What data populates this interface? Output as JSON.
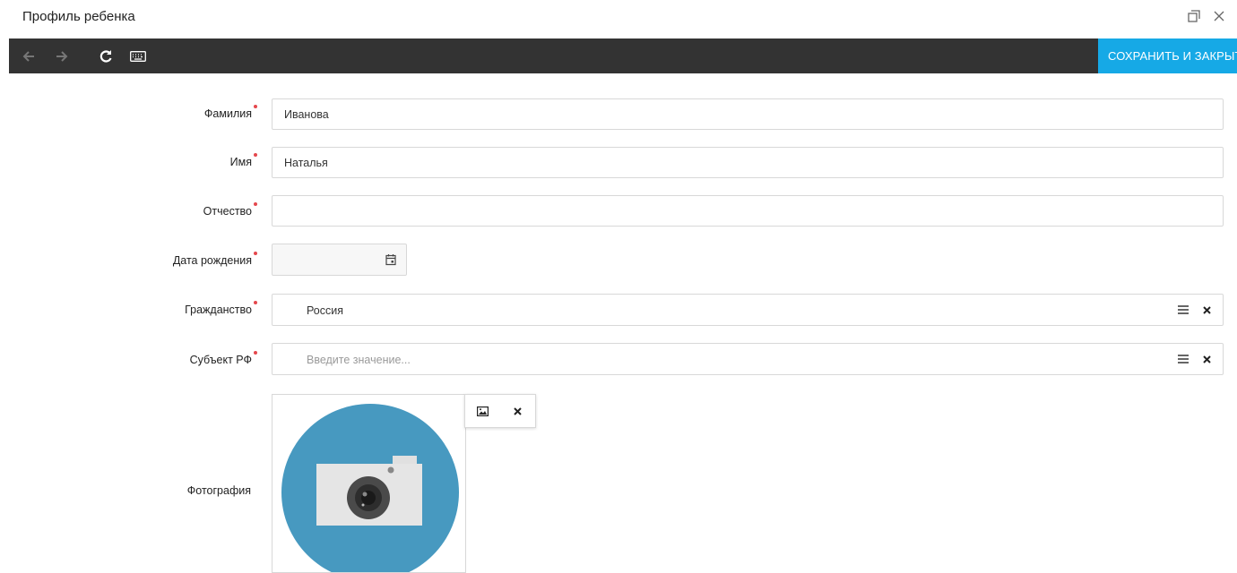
{
  "window": {
    "title": "Профиль ребенка",
    "restore_icon": "window-restore-icon",
    "close_icon": "close-icon"
  },
  "toolbar": {
    "back_icon": "arrow-left-icon",
    "forward_icon": "arrow-right-icon",
    "refresh_icon": "refresh-icon",
    "keyboard_icon": "keyboard-icon",
    "save_label": "СОХРАНИТЬ И ЗАКРЫТЬ",
    "save_color": "#16a9e6",
    "background_color": "#333333"
  },
  "form": {
    "surname": {
      "label": "Фамилия",
      "value": "Иванова",
      "required": true
    },
    "name": {
      "label": "Имя",
      "value": "Наталья",
      "required": true
    },
    "patronymic": {
      "label": "Отчество",
      "value": "",
      "required": true
    },
    "birth_date": {
      "label": "Дата рождения",
      "value": "",
      "required": true,
      "icon": "calendar-icon"
    },
    "citizenship": {
      "label": "Гражданство",
      "value": "Россия",
      "required": true,
      "list_icon": "list-icon",
      "clear_icon": "clear-icon"
    },
    "region": {
      "label": "Субъект РФ",
      "placeholder": "Введите значение...",
      "required": true,
      "list_icon": "list-icon",
      "clear_icon": "clear-icon"
    },
    "photo": {
      "label": "Фотография",
      "upload_icon": "image-icon",
      "remove_icon": "remove-icon",
      "placeholder_image": "camera-icon"
    }
  },
  "colors": {
    "required_marker": "#e5484d",
    "photo_circle": "#4799c0"
  }
}
